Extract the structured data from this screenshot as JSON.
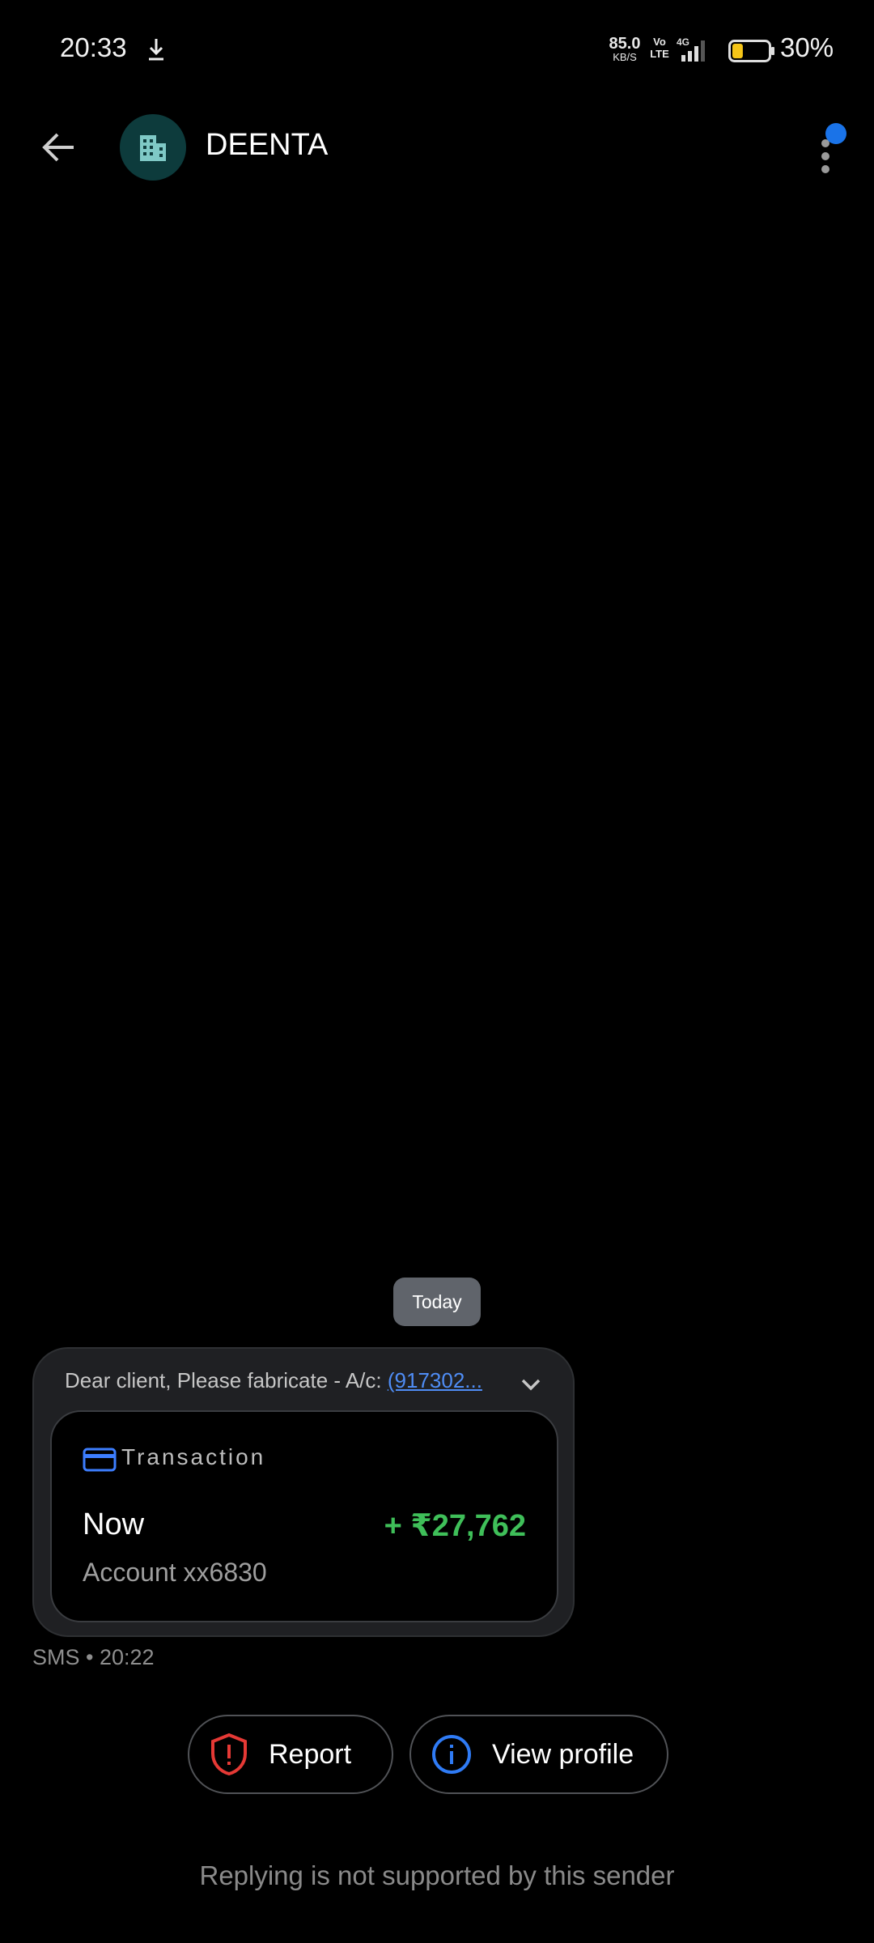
{
  "status_bar": {
    "time": "20:33",
    "net_speed_value": "85.0",
    "net_speed_unit": "KB/S",
    "volte_top": "Vo",
    "volte_bottom": "LTE",
    "network": "4G",
    "battery_level": 0.3,
    "battery_percent": "30%"
  },
  "header": {
    "sender_name": "DEENTA",
    "avatar_icon": "building-icon"
  },
  "conversation": {
    "date_chip": "Today",
    "message": {
      "preview_text": "Dear client, Please fabricate - A/c: ",
      "preview_link": "(917302...",
      "transaction": {
        "title": "Transaction",
        "when": "Now",
        "amount": "+ ₹27,762",
        "account": "Account xx6830"
      },
      "meta": "SMS • 20:22"
    }
  },
  "actions": {
    "report_label": "Report",
    "view_profile_label": "View profile"
  },
  "reply_notice": "Replying is not supported by this sender",
  "colors": {
    "background": "#000000",
    "accent_blue": "#1a73e8",
    "amount_green": "#3fbf59",
    "report_red": "#e53935",
    "avatar_bg": "#0d3b3c"
  }
}
